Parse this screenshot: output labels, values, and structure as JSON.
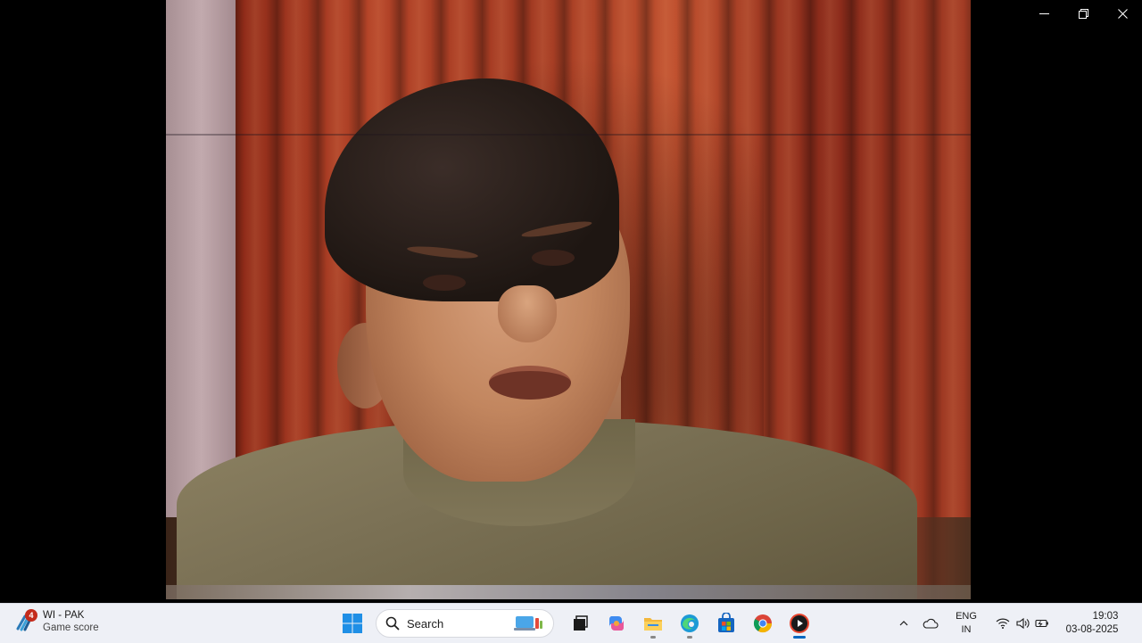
{
  "window": {
    "controls": [
      "minimize",
      "restore",
      "close"
    ]
  },
  "video": {
    "description_icon": "video-frame"
  },
  "taskbar": {
    "widget": {
      "badge": "4",
      "title": "WI - PAK",
      "subtitle": "Game score",
      "icon": "cricket-icon"
    },
    "start_icon": "windows-start-icon",
    "search": {
      "placeholder": "Search"
    },
    "apps": [
      {
        "name": "task-view",
        "icon": "task-view-icon",
        "running": false
      },
      {
        "name": "copilot",
        "icon": "copilot-icon",
        "running": false
      },
      {
        "name": "file-explorer",
        "icon": "folder-icon",
        "running": true
      },
      {
        "name": "edge",
        "icon": "edge-icon",
        "running": true
      },
      {
        "name": "microsoft-store",
        "icon": "store-icon",
        "running": false
      },
      {
        "name": "chrome",
        "icon": "chrome-icon",
        "running": false
      },
      {
        "name": "media-player",
        "icon": "media-player-icon",
        "running": true,
        "active": true
      }
    ],
    "tray": {
      "lang_top": "ENG",
      "lang_bottom": "IN",
      "time": "19:03",
      "date": "03-08-2025"
    }
  },
  "colors": {
    "taskbar_bg": "#eef0f6",
    "accent": "#0067c0",
    "badge": "#c42b1c"
  }
}
